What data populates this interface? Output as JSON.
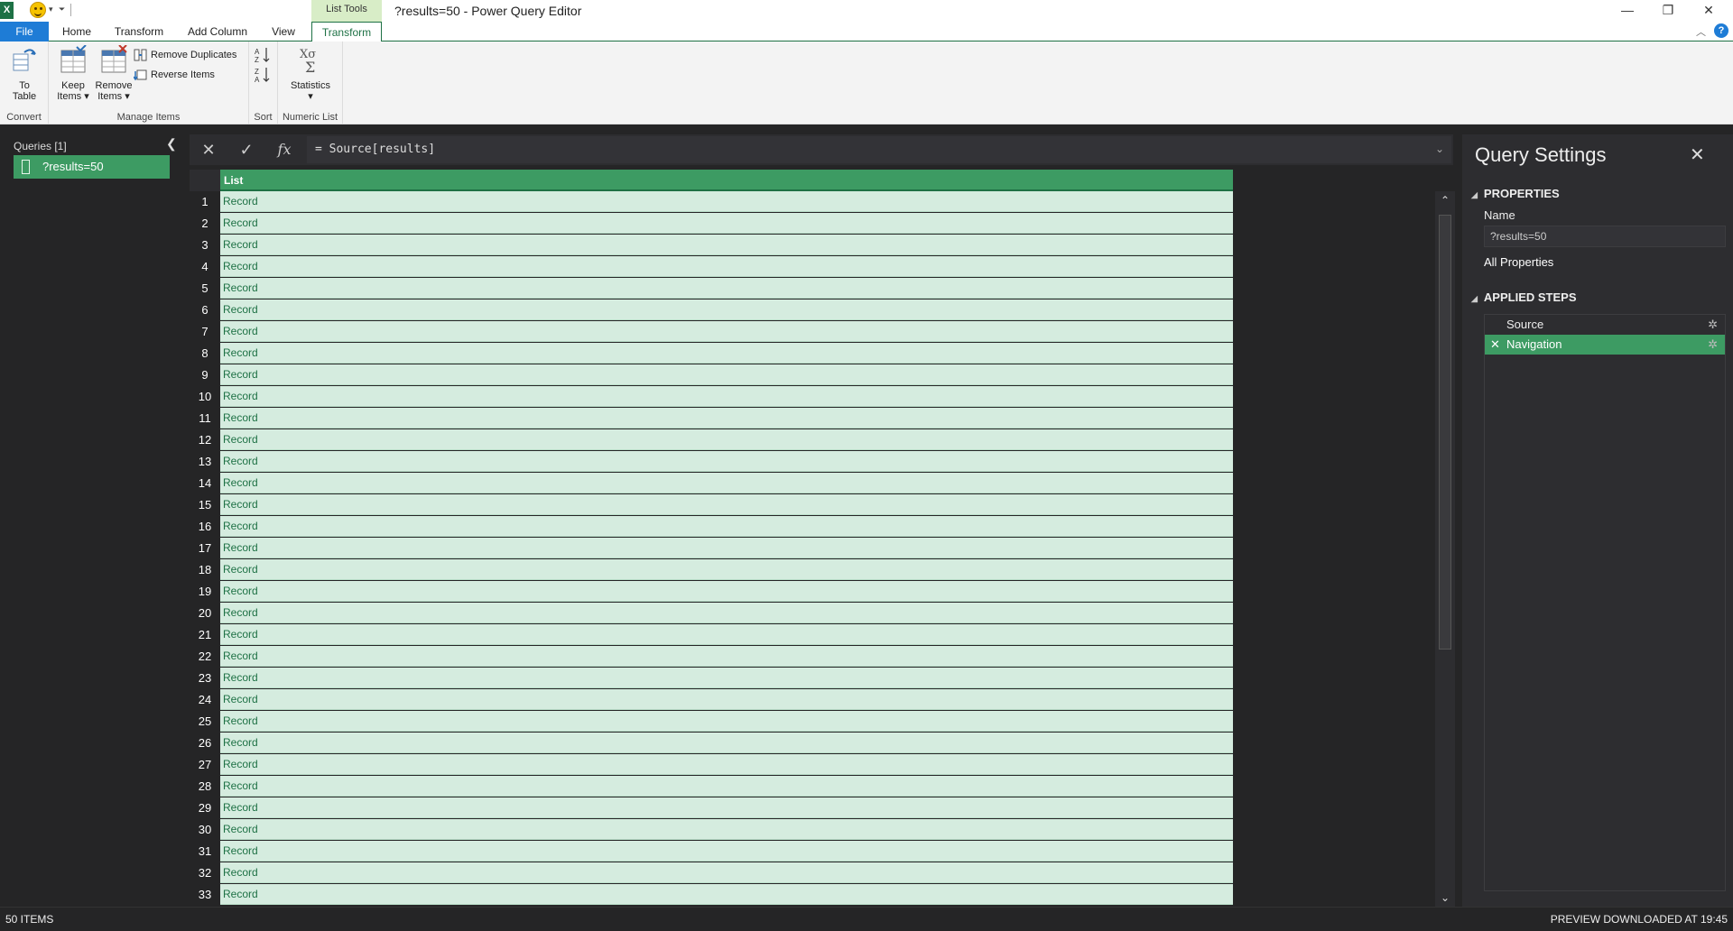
{
  "window": {
    "title": "?results=50 - Power Query Editor",
    "app_icon_letter": "X",
    "context_tab_header": "List Tools",
    "minimize": "—",
    "restore": "❐",
    "close": "✕",
    "help": "?"
  },
  "ribbon_tabs": [
    {
      "label": "File"
    },
    {
      "label": "Home"
    },
    {
      "label": "Transform"
    },
    {
      "label": "Add Column"
    },
    {
      "label": "View"
    },
    {
      "label": "Transform"
    }
  ],
  "ribbon": {
    "convert": {
      "group_label": "Convert",
      "to_table_line1": "To",
      "to_table_line2": "Table"
    },
    "manage_items": {
      "group_label": "Manage Items",
      "keep_line1": "Keep",
      "keep_line2": "Items ▾",
      "remove_line1": "Remove",
      "remove_line2": "Items ▾",
      "remove_duplicates": "Remove Duplicates",
      "reverse_items": "Reverse Items"
    },
    "sort": {
      "group_label": "Sort"
    },
    "numeric_list": {
      "group_label": "Numeric List",
      "statistics": "Statistics",
      "statistics_arrow": "▾"
    }
  },
  "queries": {
    "title": "Queries [1]",
    "collapse_glyph": "❮",
    "items": [
      {
        "label": "?results=50"
      }
    ]
  },
  "formula_bar": {
    "cancel_glyph": "✕",
    "commit_glyph": "✓",
    "fx_glyph": "fx",
    "formula": "= Source[results]",
    "expand_glyph": "⌄"
  },
  "grid": {
    "column_header": "List",
    "rows": [
      {
        "n": "1",
        "v": "Record"
      },
      {
        "n": "2",
        "v": "Record"
      },
      {
        "n": "3",
        "v": "Record"
      },
      {
        "n": "4",
        "v": "Record"
      },
      {
        "n": "5",
        "v": "Record"
      },
      {
        "n": "6",
        "v": "Record"
      },
      {
        "n": "7",
        "v": "Record"
      },
      {
        "n": "8",
        "v": "Record"
      },
      {
        "n": "9",
        "v": "Record"
      },
      {
        "n": "10",
        "v": "Record"
      },
      {
        "n": "11",
        "v": "Record"
      },
      {
        "n": "12",
        "v": "Record"
      },
      {
        "n": "13",
        "v": "Record"
      },
      {
        "n": "14",
        "v": "Record"
      },
      {
        "n": "15",
        "v": "Record"
      },
      {
        "n": "16",
        "v": "Record"
      },
      {
        "n": "17",
        "v": "Record"
      },
      {
        "n": "18",
        "v": "Record"
      },
      {
        "n": "19",
        "v": "Record"
      },
      {
        "n": "20",
        "v": "Record"
      },
      {
        "n": "21",
        "v": "Record"
      },
      {
        "n": "22",
        "v": "Record"
      },
      {
        "n": "23",
        "v": "Record"
      },
      {
        "n": "24",
        "v": "Record"
      },
      {
        "n": "25",
        "v": "Record"
      },
      {
        "n": "26",
        "v": "Record"
      },
      {
        "n": "27",
        "v": "Record"
      },
      {
        "n": "28",
        "v": "Record"
      },
      {
        "n": "29",
        "v": "Record"
      },
      {
        "n": "30",
        "v": "Record"
      },
      {
        "n": "31",
        "v": "Record"
      },
      {
        "n": "32",
        "v": "Record"
      },
      {
        "n": "33",
        "v": "Record"
      }
    ],
    "scroll_up": "⌃",
    "scroll_down": "⌄"
  },
  "settings": {
    "title": "Query Settings",
    "close_glyph": "✕",
    "properties_label": "PROPERTIES",
    "name_label": "Name",
    "name_value": "?results=50",
    "all_properties": "All Properties",
    "applied_steps_label": "APPLIED STEPS",
    "triangle": "◢",
    "steps": [
      {
        "label": "Source",
        "gear": "✲",
        "active": false
      },
      {
        "label": "Navigation",
        "gear": "✲",
        "active": true,
        "delete_glyph": "✕"
      }
    ]
  },
  "status": {
    "left": "50 ITEMS",
    "right": "PREVIEW DOWNLOADED AT 19:45"
  },
  "colors": {
    "accent_green": "#3d9b63",
    "excel_green": "#1e7145",
    "file_blue": "#1e7cd6",
    "cell_bg": "#d5ecdf"
  }
}
